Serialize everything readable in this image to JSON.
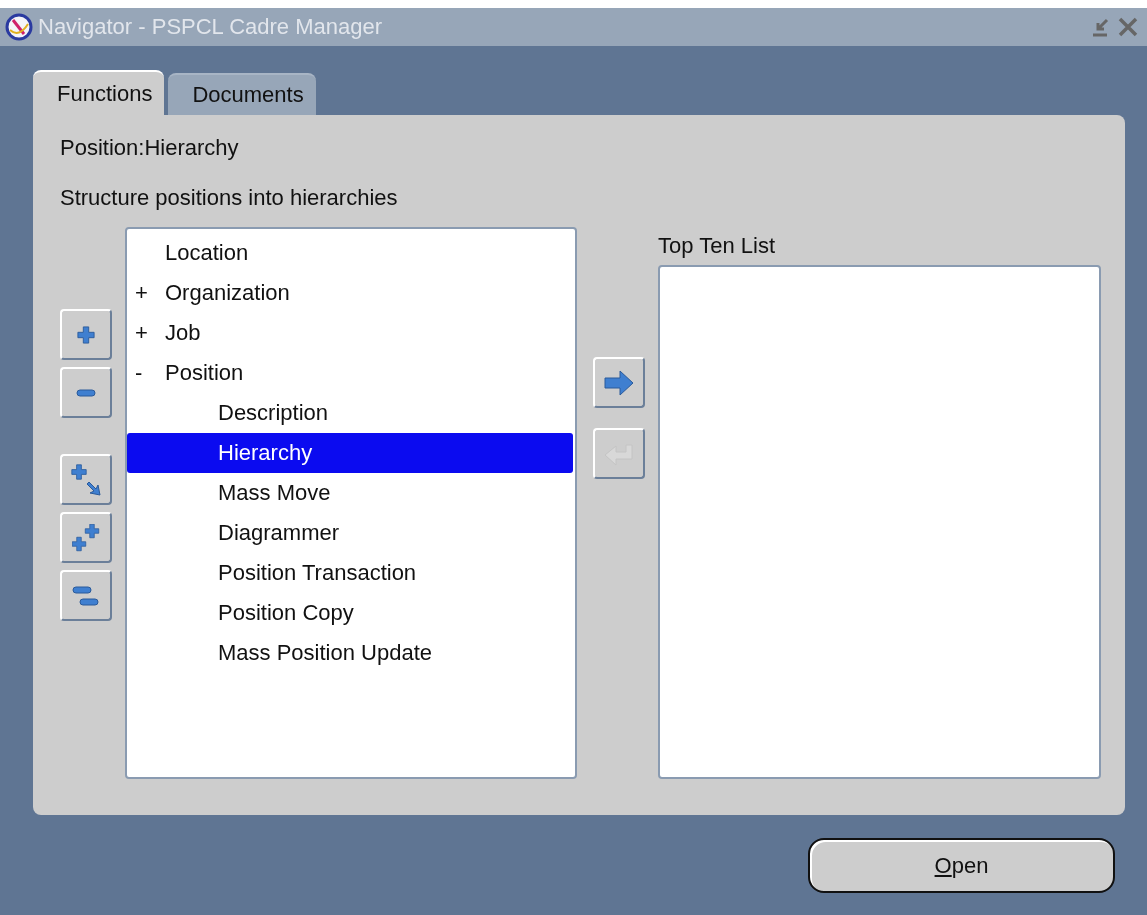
{
  "window": {
    "title": "Navigator - PSPCL Cadre Manager"
  },
  "tabs": [
    {
      "label": "Functions",
      "selected": true
    },
    {
      "label": "Documents",
      "selected": false
    }
  ],
  "function_name": "Position:Hierarchy",
  "function_description": "Structure positions into hierarchies",
  "tree": [
    {
      "label": "Location",
      "selected": false
    },
    {
      "label": "Organization",
      "toggle": "+",
      "selected": false
    },
    {
      "label": "Job",
      "toggle": "+",
      "selected": false
    },
    {
      "label": "Position",
      "toggle": "-",
      "selected": false,
      "children": [
        {
          "label": "Description",
          "selected": false
        },
        {
          "label": "Hierarchy",
          "selected": true
        },
        {
          "label": "Mass Move",
          "selected": false
        },
        {
          "label": "Diagrammer",
          "selected": false
        },
        {
          "label": "Position Transaction",
          "selected": false
        },
        {
          "label": "Position Copy",
          "selected": false
        },
        {
          "label": "Mass Position Update",
          "selected": false
        }
      ]
    }
  ],
  "tree_buttons": [
    {
      "kind": "expand"
    },
    {
      "kind": "collapse"
    },
    {
      "kind": "expand-branch"
    },
    {
      "kind": "expand-all"
    },
    {
      "kind": "collapse-all"
    }
  ],
  "transfer_buttons": [
    {
      "kind": "add",
      "disabled": false
    },
    {
      "kind": "remove",
      "disabled": true
    }
  ],
  "top_ten": {
    "label": "Top Ten List"
  },
  "open_button": {
    "label": "Open"
  }
}
